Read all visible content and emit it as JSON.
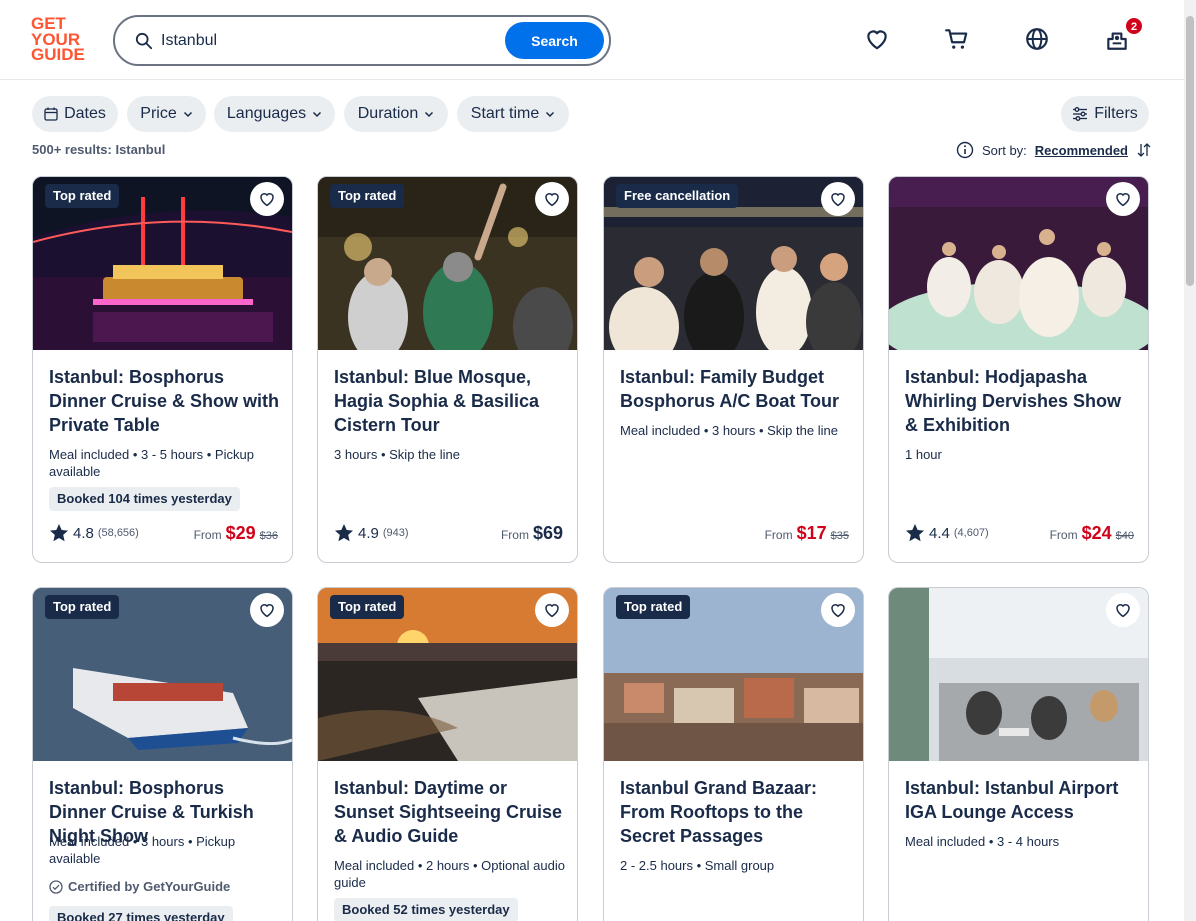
{
  "header": {
    "logo_lines": [
      "GET",
      "YOUR",
      "GUIDE"
    ],
    "search_value": "Istanbul",
    "search_button": "Search",
    "cart_badge": "2",
    "icons": [
      "heart-icon",
      "cart-icon",
      "globe-icon",
      "account-icon"
    ]
  },
  "filters": {
    "dates": "Dates",
    "price": "Price",
    "languages": "Languages",
    "duration": "Duration",
    "start_time": "Start time",
    "filters": "Filters"
  },
  "results": {
    "count": "500+ results: Istanbul",
    "sort_label": "Sort by:",
    "sort_value": "Recommended"
  },
  "cards": [
    {
      "tag": "Top rated",
      "title": "Istanbul: Bosphorus Dinner Cruise & Show with Private Table",
      "meta": "Meal included • 3 - 5 hours • Pickup available",
      "booked": "Booked 104 times yesterday",
      "rating": "4.8",
      "reviews": "(58,656)",
      "from": "From",
      "price": "$29",
      "old_price": "$36"
    },
    {
      "tag": "Top rated",
      "title": "Istanbul: Blue Mosque, Hagia Sophia & Basilica Cistern Tour",
      "meta": "3 hours • Skip the line",
      "rating": "4.9",
      "reviews": "(943)",
      "from": "From",
      "price": "$69"
    },
    {
      "tag": "Free cancellation",
      "title": "Istanbul: Family Budget Bosphorus A/C Boat Tour",
      "meta": "Meal included • 3 hours • Skip the line",
      "from": "From",
      "price": "$17",
      "old_price": "$35"
    },
    {
      "title": "Istanbul: Hodjapasha Whirling Dervishes Show & Exhibition",
      "meta": "1 hour",
      "rating": "4.4",
      "reviews": "(4,607)",
      "from": "From",
      "price": "$24",
      "old_price": "$40"
    },
    {
      "tag": "Top rated",
      "title": "Istanbul: Bosphorus Dinner Cruise & Turkish Night Show",
      "meta": "Meal included • 3 hours • Pickup available",
      "certified": "Certified by GetYourGuide",
      "booked": "Booked 27 times yesterday"
    },
    {
      "tag": "Top rated",
      "title": "Istanbul: Daytime or Sunset Sightseeing Cruise & Audio Guide",
      "meta": "Meal included • 2 hours • Optional audio guide",
      "booked": "Booked 52 times yesterday"
    },
    {
      "tag": "Top rated",
      "title": "Istanbul Grand Bazaar: From Rooftops to the Secret Passages",
      "meta": "2 - 2.5 hours • Small group"
    },
    {
      "title": "Istanbul: Istanbul Airport IGA Lounge Access",
      "meta": "Meal included • 3 - 4 hours"
    }
  ]
}
